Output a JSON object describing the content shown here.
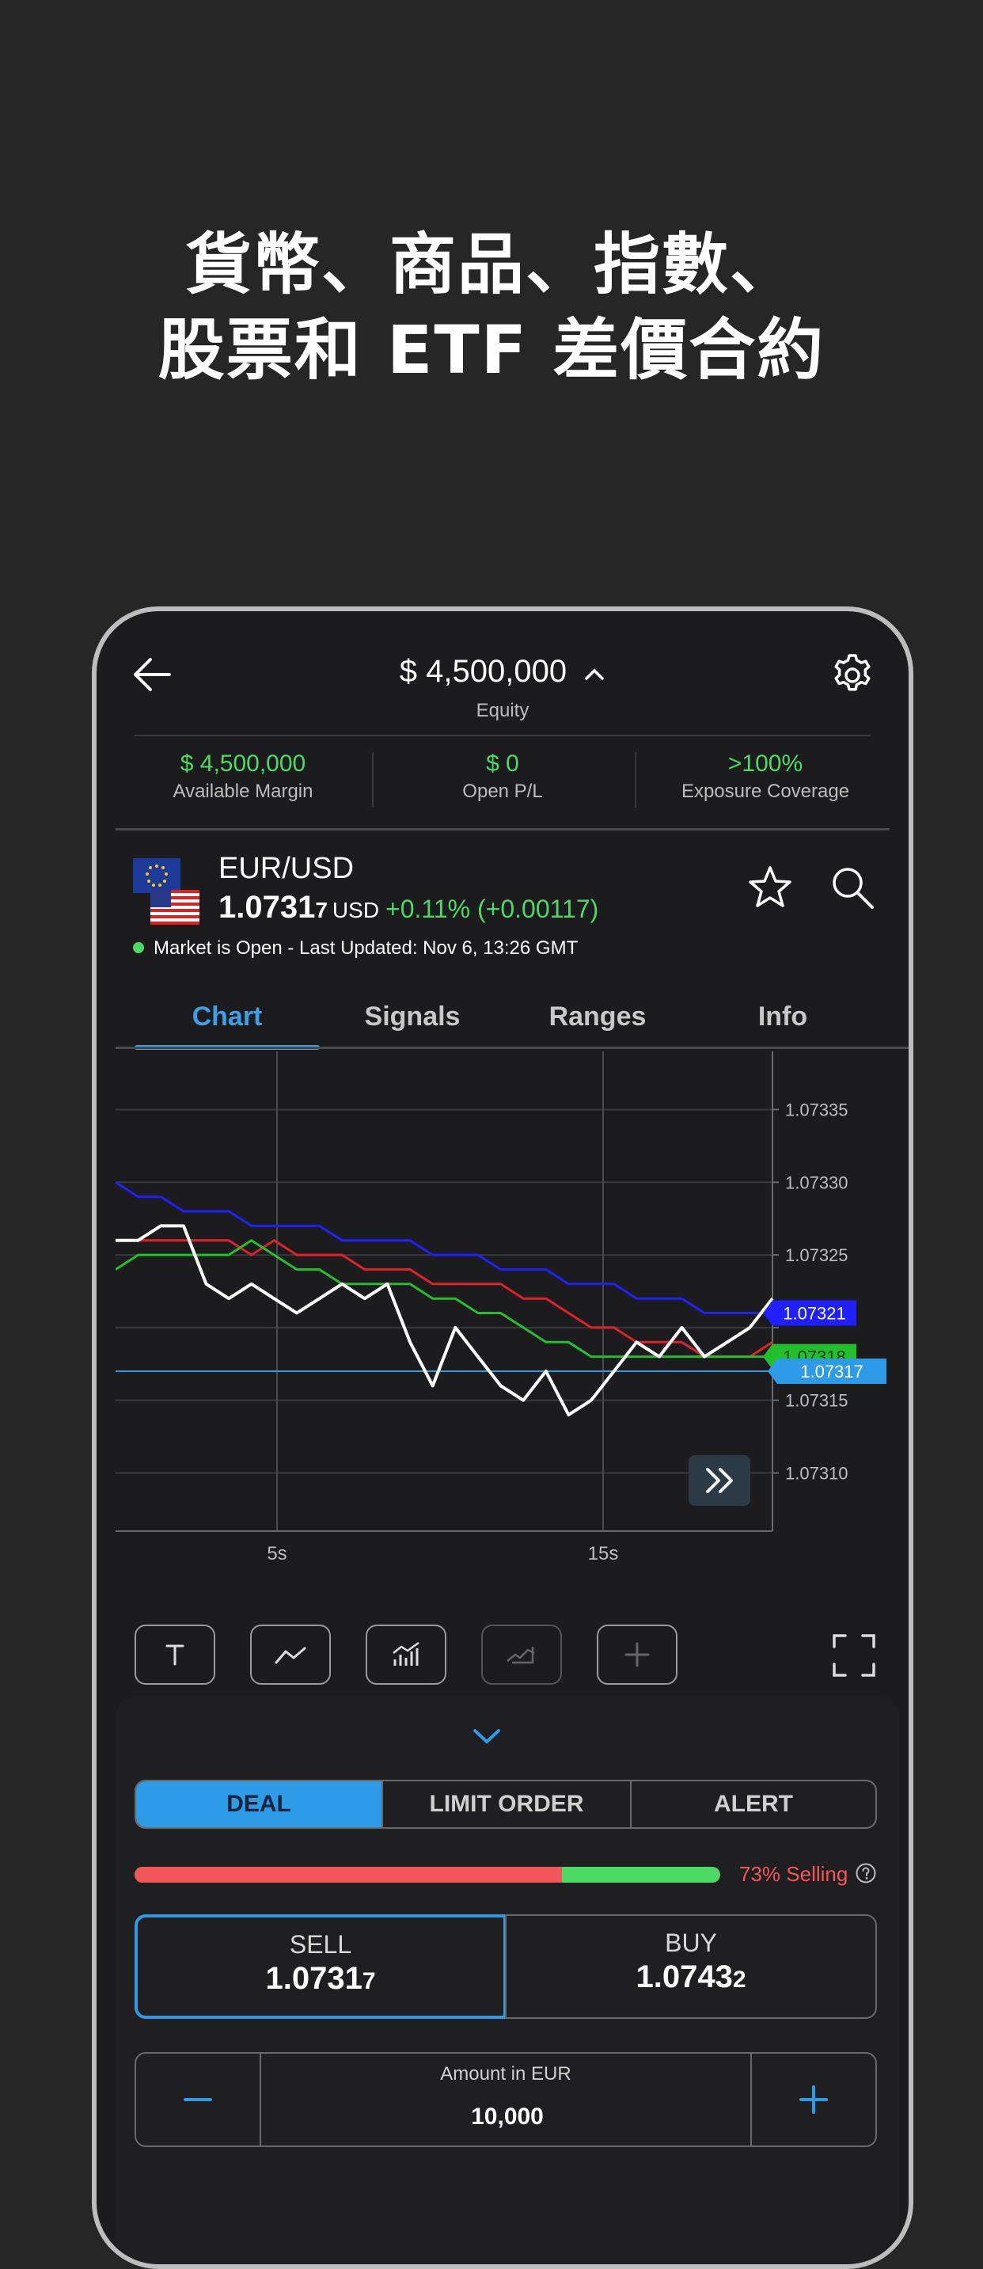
{
  "promo": {
    "line1": "貨幣、商品、指數、",
    "line2": "股票和 ETF 差價合約"
  },
  "header": {
    "equity_value": "$ 4,500,000",
    "equity_label": "Equity"
  },
  "stats": [
    {
      "value": "$ 4,500,000",
      "label": "Available Margin"
    },
    {
      "value": "$ 0",
      "label": "Open P/L"
    },
    {
      "value": ">100%",
      "label": "Exposure Coverage"
    }
  ],
  "instrument": {
    "name": "EUR/USD",
    "price_main": "1.0731",
    "price_small": "7",
    "price_unit": "USD",
    "change": "+0.11% (+0.00117)",
    "status": "Market is Open - Last Updated: Nov 6, 13:26 GMT"
  },
  "tabs": [
    "Chart",
    "Signals",
    "Ranges",
    "Info"
  ],
  "chart_data": {
    "type": "line",
    "x_ticks": [
      "5s",
      "15s"
    ],
    "y_ticks": [
      1.07335,
      1.0733,
      1.07325,
      1.0732,
      1.07315,
      1.0731
    ],
    "y_tick_labels": [
      "1.07335",
      "1.07330",
      "1.07325",
      "",
      "1.07315",
      "1.07310"
    ],
    "ylim": [
      1.07306,
      1.07339
    ],
    "xlim": [
      0,
      20
    ],
    "grid": true,
    "price_line": 1.07317,
    "tags": [
      {
        "label": "1.07321",
        "value": 1.07321,
        "color": "#1f1fff"
      },
      {
        "label": "1.07318",
        "value": 1.07318,
        "color": "#22c02a"
      },
      {
        "label": "1.07317",
        "value": 1.07317,
        "color": "#2e9be8"
      }
    ],
    "series": [
      {
        "color": "#ffffff",
        "values": [
          1.07326,
          1.07326,
          1.07327,
          1.07327,
          1.07323,
          1.07322,
          1.07323,
          1.07322,
          1.07321,
          1.07322,
          1.07323,
          1.07322,
          1.07323,
          1.07319,
          1.07316,
          1.0732,
          1.07318,
          1.07316,
          1.07315,
          1.07317,
          1.07314,
          1.07315,
          1.07317,
          1.07319,
          1.07318,
          1.0732,
          1.07318,
          1.07319,
          1.0732,
          1.07322
        ]
      },
      {
        "color": "#1f1fff",
        "values": [
          1.0733,
          1.07329,
          1.07329,
          1.07328,
          1.07328,
          1.07328,
          1.07327,
          1.07327,
          1.07327,
          1.07327,
          1.07326,
          1.07326,
          1.07326,
          1.07326,
          1.07325,
          1.07325,
          1.07325,
          1.07324,
          1.07324,
          1.07324,
          1.07323,
          1.07323,
          1.07323,
          1.07322,
          1.07322,
          1.07322,
          1.07321,
          1.07321,
          1.07321,
          1.07321
        ]
      },
      {
        "color": "#e0202a",
        "values": [
          1.07326,
          1.07326,
          1.07326,
          1.07326,
          1.07326,
          1.07326,
          1.07325,
          1.07326,
          1.07325,
          1.07325,
          1.07325,
          1.07324,
          1.07324,
          1.07324,
          1.07323,
          1.07323,
          1.07323,
          1.07323,
          1.07322,
          1.07322,
          1.07321,
          1.0732,
          1.0732,
          1.07319,
          1.07319,
          1.07319,
          1.07318,
          1.07318,
          1.07318,
          1.07319
        ]
      },
      {
        "color": "#22c02a",
        "values": [
          1.07324,
          1.07325,
          1.07325,
          1.07325,
          1.07325,
          1.07325,
          1.07326,
          1.07325,
          1.07324,
          1.07324,
          1.07323,
          1.07323,
          1.07323,
          1.07323,
          1.07322,
          1.07322,
          1.07321,
          1.07321,
          1.0732,
          1.07319,
          1.07319,
          1.07318,
          1.07318,
          1.07318,
          1.07318,
          1.07318,
          1.07318,
          1.07318,
          1.07318,
          1.07318
        ]
      }
    ]
  },
  "deal_tabs": [
    "DEAL",
    "LIMIT ORDER",
    "ALERT"
  ],
  "sentiment": {
    "sell_fraction": 0.73,
    "label": "73% Selling"
  },
  "sell": {
    "label": "SELL",
    "price_main": "1.0731",
    "price_small": "7"
  },
  "buy": {
    "label": "BUY",
    "price_main": "1.0743",
    "price_small": "2"
  },
  "amount": {
    "label": "Amount in EUR",
    "value": "10,000"
  },
  "colors": {
    "accent": "#2e9be8",
    "positive": "#4cd964",
    "negative": "#f0565a"
  }
}
